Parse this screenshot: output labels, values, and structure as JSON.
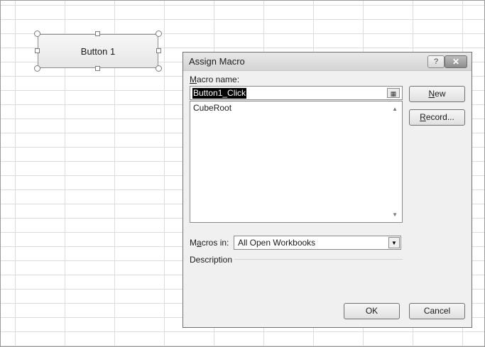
{
  "worksheet": {
    "form_button": {
      "label": "Button 1"
    }
  },
  "dialog": {
    "title": "Assign Macro",
    "help_button": "?",
    "close_button": "✕",
    "macro_name": {
      "label_prefix": "M",
      "label_rest": "acro name:",
      "value": "Button1_Click",
      "picker_icon": "cell-picker-icon"
    },
    "macro_list": [
      "CubeRoot"
    ],
    "buttons": {
      "new": {
        "accel": "N",
        "rest": "ew"
      },
      "record": {
        "accel": "R",
        "rest": "ecord..."
      },
      "ok": "OK",
      "cancel": "Cancel"
    },
    "macros_in": {
      "label_a": "M",
      "label_accel": "a",
      "label_b": "cros in:",
      "selected": "All Open Workbooks"
    },
    "description_label": "Description"
  }
}
